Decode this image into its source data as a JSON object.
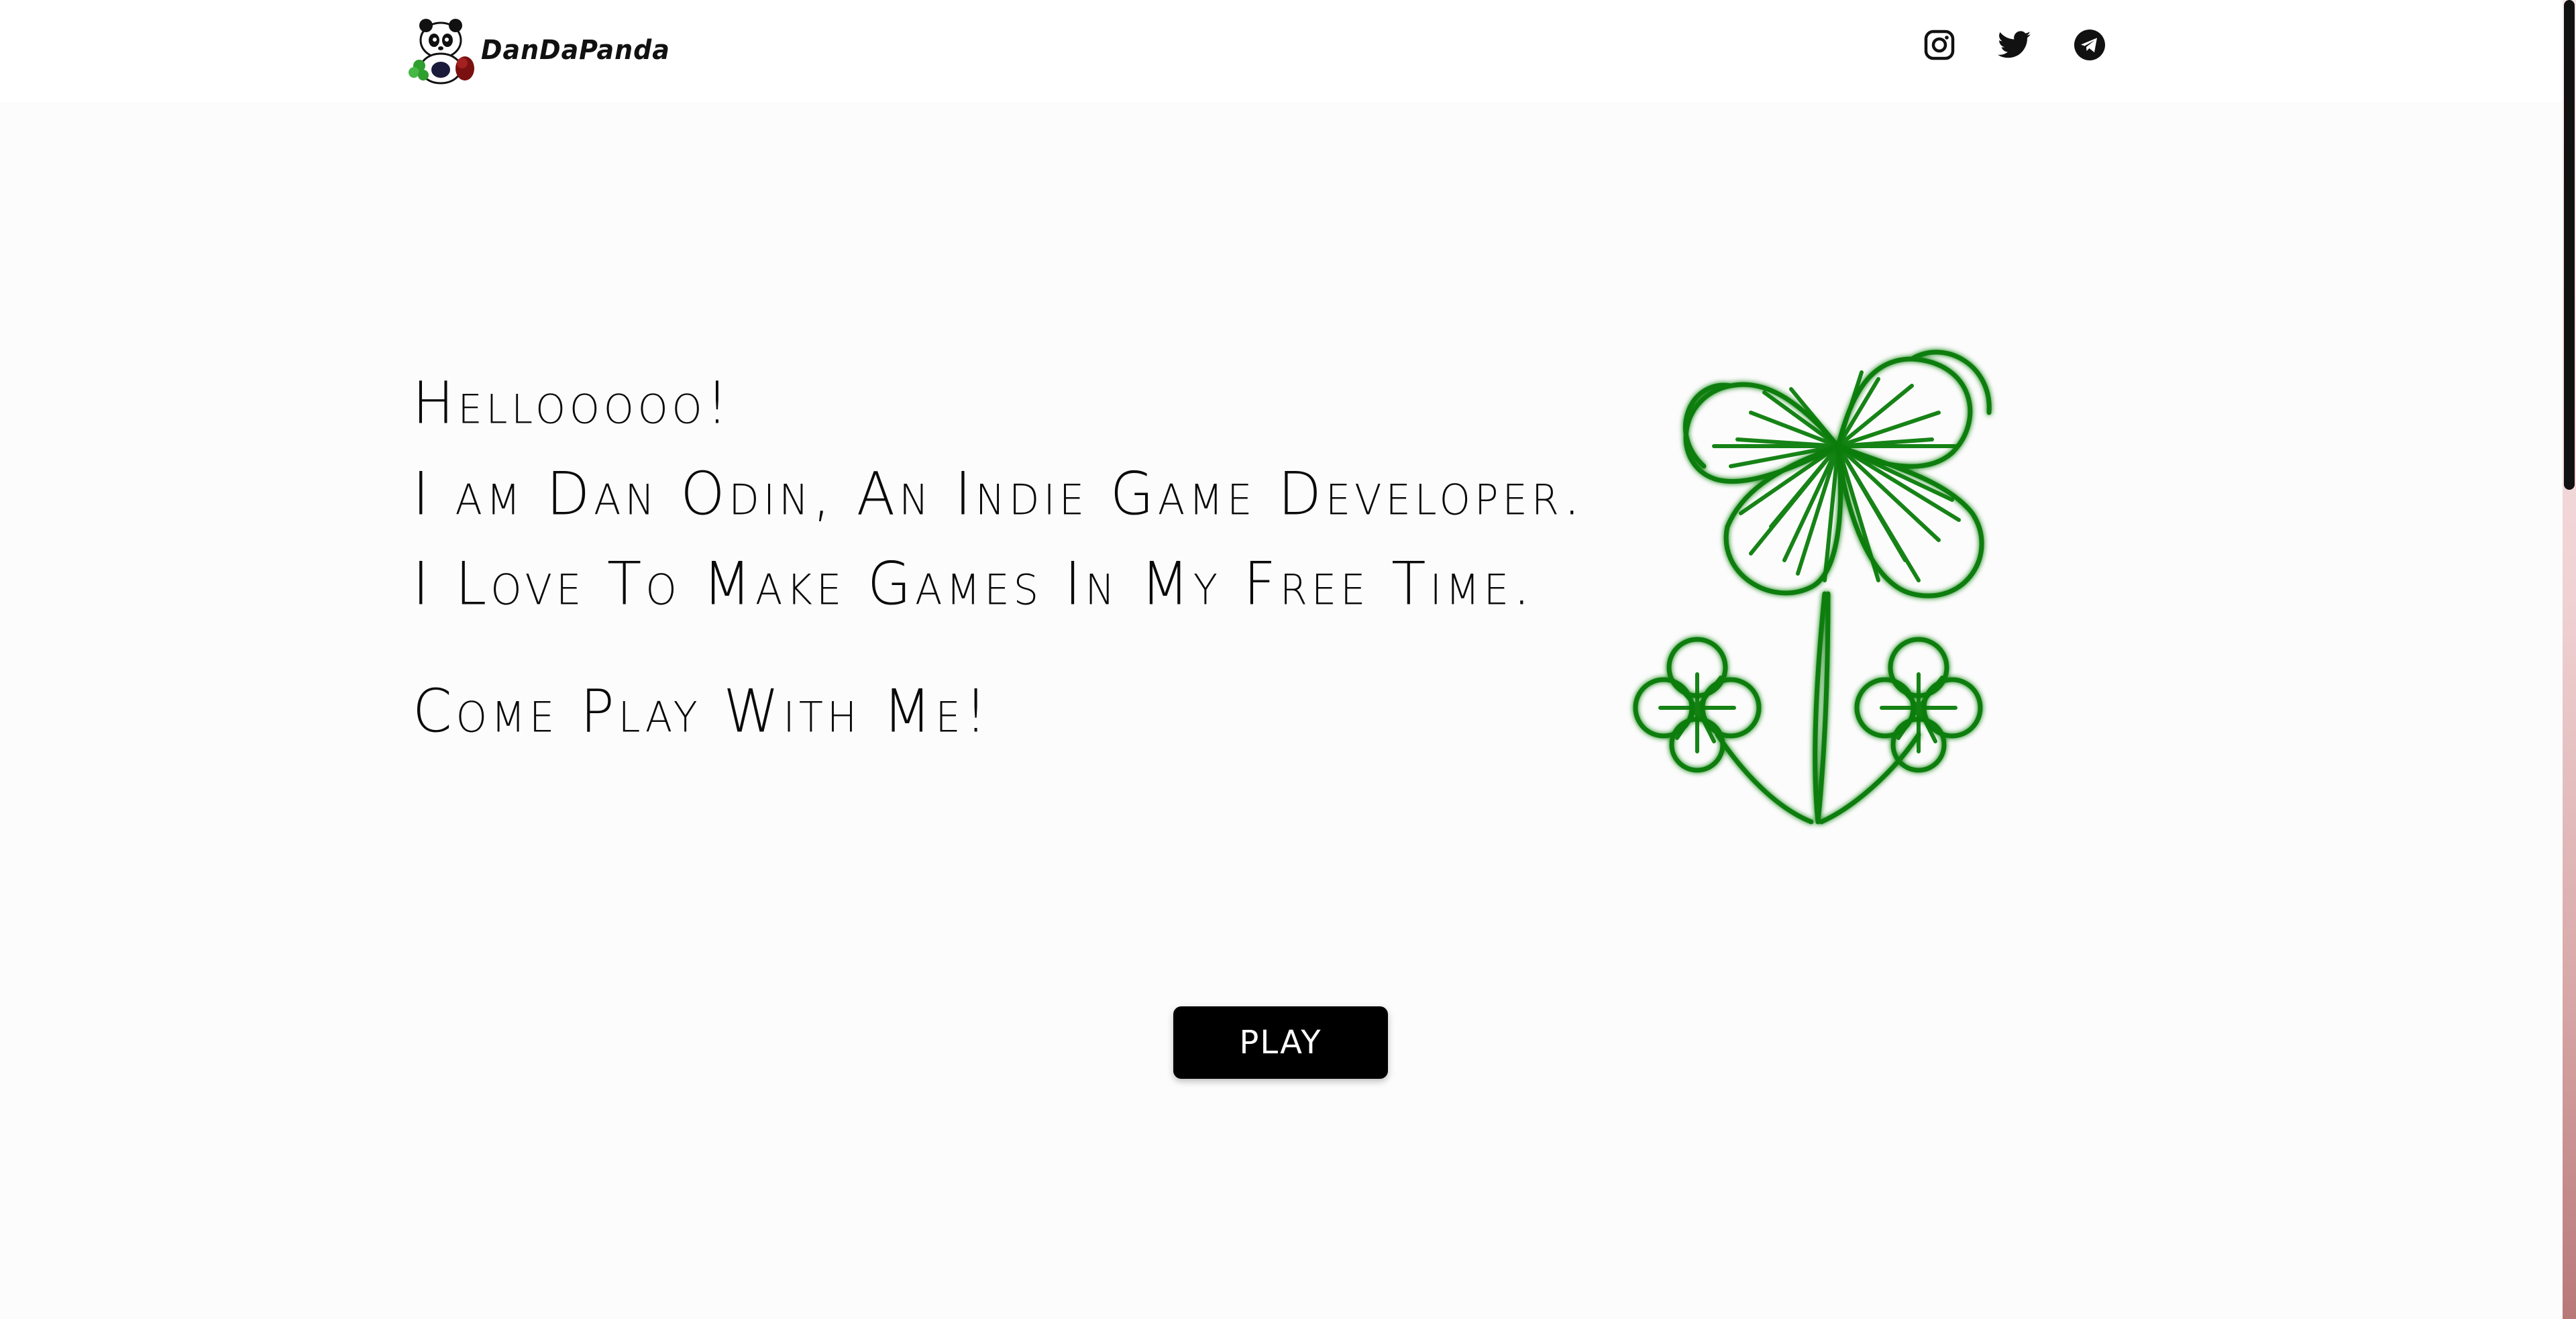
{
  "header": {
    "brand_name": "DanDaPanda",
    "social_icons": [
      "instagram-icon",
      "twitter-icon",
      "telegram-icon"
    ]
  },
  "hero": {
    "line1": "Hellooooo!",
    "line2": "I am Dan Odin, An Indie Game Developer.",
    "line3": "I Love To Make Games In My Free Time.",
    "line4": "Come Play With Me!"
  },
  "illustration": {
    "icon": "four-leaf-clover-icon",
    "color": "#0a7d0a"
  },
  "play_button": {
    "label": "PLAY"
  },
  "colors": {
    "background": "#fcfcfc",
    "text": "#0a0a0a",
    "button_bg": "#000000",
    "button_text": "#ffffff",
    "accent_green": "#0a7d0a"
  }
}
